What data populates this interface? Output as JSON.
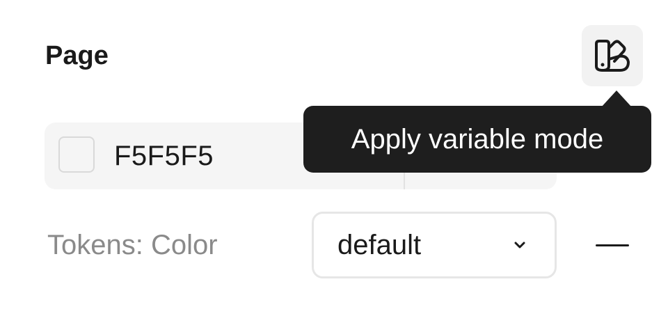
{
  "section": {
    "title": "Page"
  },
  "variable_mode_button": {
    "icon": "variable-mode-icon",
    "tooltip": "Apply variable mode"
  },
  "fill": {
    "swatch_color": "#F5F5F5",
    "hex": "F5F5F5"
  },
  "token": {
    "label": "Tokens: Color",
    "mode_value": "default",
    "dropdown_icon": "chevron-down-icon",
    "remove_icon": "minus-icon"
  },
  "colors": {
    "tooltip_bg": "#1E1E1E",
    "text": "#1A1A1A",
    "muted_text": "#8A8A8A",
    "row_bg": "#F5F5F5"
  }
}
